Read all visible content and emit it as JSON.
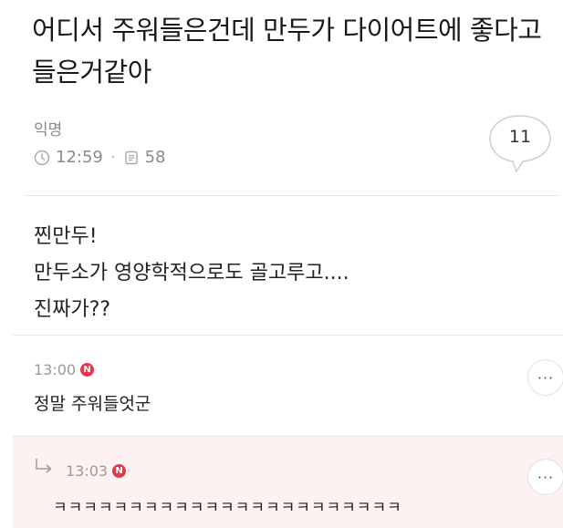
{
  "post": {
    "title": "어디서 주워들은건데 만두가 다이어트에 좋다고 들은거같아",
    "author": "익명",
    "time": "12:59",
    "views": "58",
    "comment_count": "11",
    "content_lines": [
      "찐만두!",
      "만두소가 영양학적으로도 골고루고....",
      "진짜가??"
    ]
  },
  "comments": [
    {
      "time": "13:00",
      "badge": "N",
      "text": "정말 주워들엇군",
      "more": "···"
    },
    {
      "time": "13:03",
      "badge": "N",
      "text": "ㅋㅋㅋㅋㅋㅋㅋㅋㅋㅋㅋㅋㅋㅋㅋㅋㅋㅋㅋㅋㅋㅋㅋ",
      "more": "···"
    }
  ],
  "colors": {
    "badge": "#e0394a",
    "reply_bg": "#fdf1f1",
    "meta": "#8a8a8a"
  },
  "icons": [
    "clock-icon",
    "document-icon",
    "speech-bubble-icon",
    "reply-arrow-icon",
    "more-icon"
  ]
}
